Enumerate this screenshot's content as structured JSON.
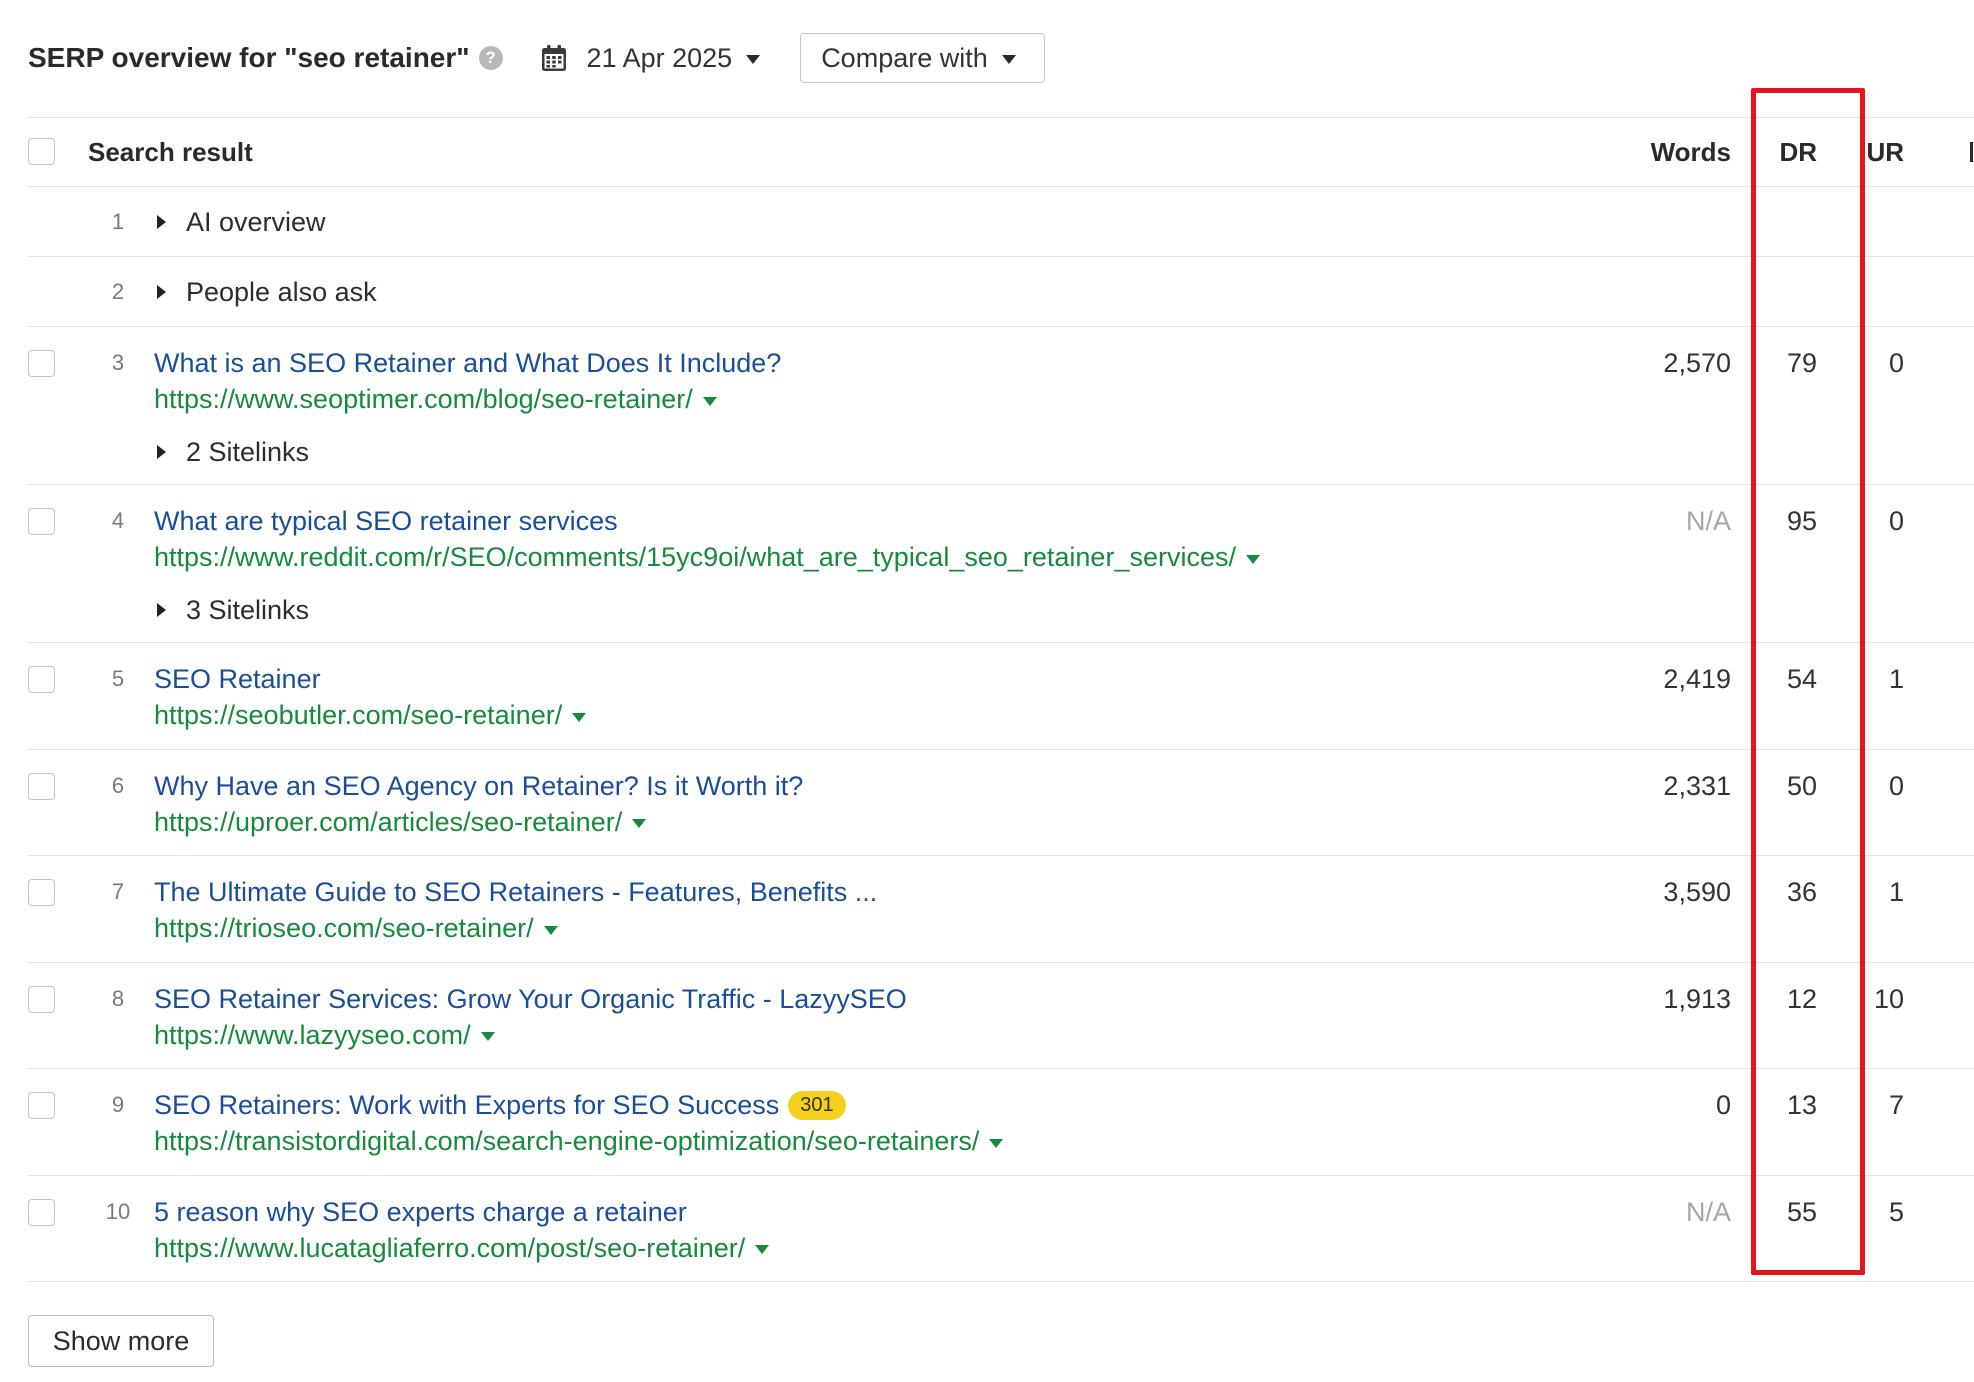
{
  "toolbar": {
    "title": "SERP overview for \"seo retainer\"",
    "date": "21 Apr 2025",
    "compare_label": "Compare with"
  },
  "icons": {
    "help": "help-icon",
    "calendar": "calendar-icon",
    "date_caret": "chevron-down-icon",
    "compare_caret": "chevron-down-icon",
    "expand": "triangle-right-icon",
    "url_menu": "triangle-down-icon"
  },
  "table": {
    "columns": {
      "search_result": "Search result",
      "words": "Words",
      "dr": "DR",
      "ur": "UR"
    },
    "rows": [
      {
        "position": "1",
        "label": "AI overview"
      },
      {
        "position": "2",
        "label": "People also ask"
      },
      {
        "position": "3",
        "title": "What is an SEO Retainer and What Does It Include?",
        "url": "https://www.seoptimer.com/blog/seo-retainer/",
        "sitelinks": "2 Sitelinks",
        "words": "2,570",
        "dr": "79",
        "ur": "0"
      },
      {
        "position": "4",
        "title": "What are typical SEO retainer services",
        "url": "https://www.reddit.com/r/SEO/comments/15yc9oi/what_are_typical_seo_retainer_services/",
        "sitelinks": "3 Sitelinks",
        "words": "N/A",
        "dr": "95",
        "ur": "0"
      },
      {
        "position": "5",
        "title": "SEO Retainer",
        "url": "https://seobutler.com/seo-retainer/",
        "words": "2,419",
        "dr": "54",
        "ur": "1"
      },
      {
        "position": "6",
        "title": "Why Have an SEO Agency on Retainer? Is it Worth it?",
        "url": "https://uproer.com/articles/seo-retainer/",
        "words": "2,331",
        "dr": "50",
        "ur": "0"
      },
      {
        "position": "7",
        "title": "The Ultimate Guide to SEO Retainers - Features, Benefits ...",
        "url": "https://trioseo.com/seo-retainer/",
        "words": "3,590",
        "dr": "36",
        "ur": "1"
      },
      {
        "position": "8",
        "title": "SEO Retainer Services: Grow Your Organic Traffic - LazyySEO",
        "url": "https://www.lazyyseo.com/",
        "words": "1,913",
        "dr": "12",
        "ur": "10"
      },
      {
        "position": "9",
        "title": "SEO Retainers: Work with Experts for SEO Success",
        "badge": "301",
        "url": "https://transistordigital.com/search-engine-optimization/seo-retainers/",
        "words": "0",
        "dr": "13",
        "ur": "7"
      },
      {
        "position": "10",
        "title": "5 reason why SEO experts charge a retainer",
        "url": "https://www.lucatagliaferro.com/post/seo-retainer/",
        "words": "N/A",
        "dr": "55",
        "ur": "5"
      }
    ]
  },
  "show_more_label": "Show more",
  "colors": {
    "title_link": "#1a4e9a",
    "url": "#178a3e",
    "badge": "#f5d11f",
    "highlight_box": "#e8131b",
    "muted": "#a6a6a6"
  }
}
